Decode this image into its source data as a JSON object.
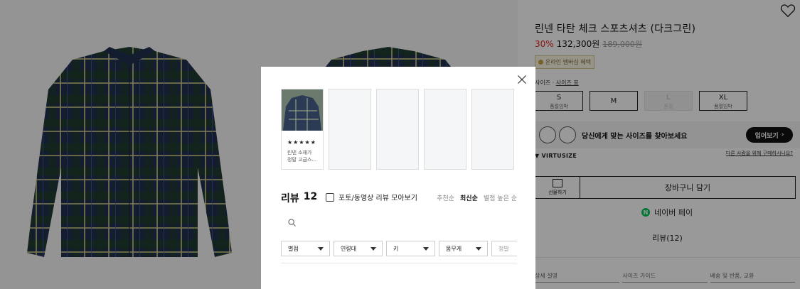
{
  "product": {
    "title": "린넨 타탄 체크 스포츠셔츠 (다크그린)",
    "discount": "30%",
    "price": "132,300원",
    "original_price": "189,000원",
    "badge": "온라인 멤버십 혜택",
    "size_label": "사이즈 ·",
    "size_guide_link": "사이즈 표",
    "sizes": [
      {
        "label": "S",
        "status": "품절임박"
      },
      {
        "label": "M",
        "status": ""
      },
      {
        "label": "L",
        "status": "품절"
      },
      {
        "label": "XL",
        "status": "품절임박"
      }
    ],
    "virtusize_text": "당신에게 맞는 사이즈를 찾아보세요",
    "virtusize_button": "입어보기",
    "virtusize_logo": "VIRTUSIZE",
    "virtusize_link": "다른 사람을 위해 구매하시나요?",
    "gift_label": "선물하기",
    "cart_label": "장바구니 담기",
    "npay_icon": "N",
    "npay_label": "네이버 페이",
    "reviews_link": "리뷰(12)",
    "bottom_tabs": [
      "상세 설명",
      "사이즈 가이드",
      "배송 및 반품, 교환"
    ]
  },
  "modal": {
    "thumbnail": {
      "stars": "★★★★★",
      "text_line1": "린넨 소재가",
      "text_line2": "정말 고급스..."
    },
    "review_title": "리뷰",
    "review_count": "12",
    "photo_only_label": "포토/동영상 리뷰 모아보기",
    "sort_options": [
      "추천순",
      "최신순",
      "별점 높은 순"
    ],
    "sort_active": "최신순",
    "search_placeholder": "",
    "filters": [
      "별점",
      "연령대",
      "키",
      "몸무게",
      "정발"
    ]
  },
  "colors": {
    "discount": "#e0241b",
    "overlay": "rgba(0,0,0,0.4)",
    "npay": "#03c75a"
  }
}
